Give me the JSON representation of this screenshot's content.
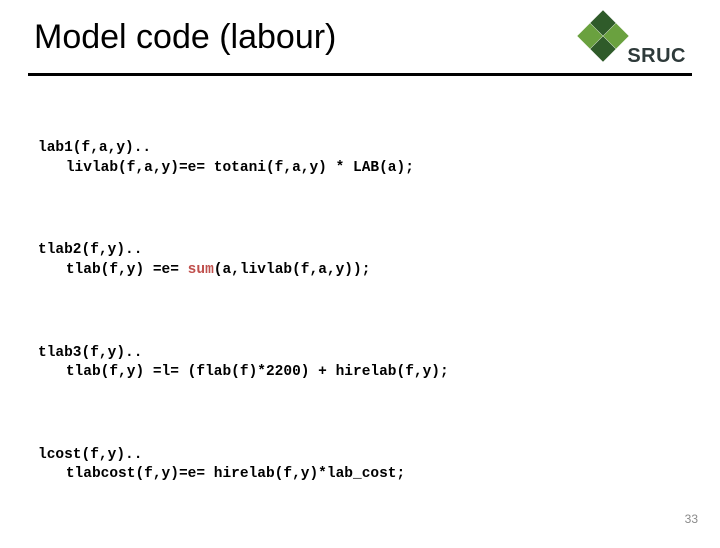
{
  "header": {
    "title": "Model code (labour)",
    "logo_text": "SRUC"
  },
  "code": {
    "b1_l1": "lab1(f,a,y)..",
    "b1_l2": "livlab(f,a,y)=e= totani(f,a,y) * LAB(a);",
    "b2_l1": "tlab2(f,y)..",
    "b2_l2a": "tlab(f,y) =e= ",
    "b2_sum": "sum",
    "b2_l2b": "(a,livlab(f,a,y));",
    "b3_l1": "tlab3(f,y)..",
    "b3_l2": "tlab(f,y) =l= (flab(f)*2200) + hirelab(f,y);",
    "b4_l1": "lcost(f,y)..",
    "b4_l2": "tlabcost(f,y)=e= hirelab(f,y)*lab_cost;"
  },
  "footer": {
    "page_number": "33"
  }
}
